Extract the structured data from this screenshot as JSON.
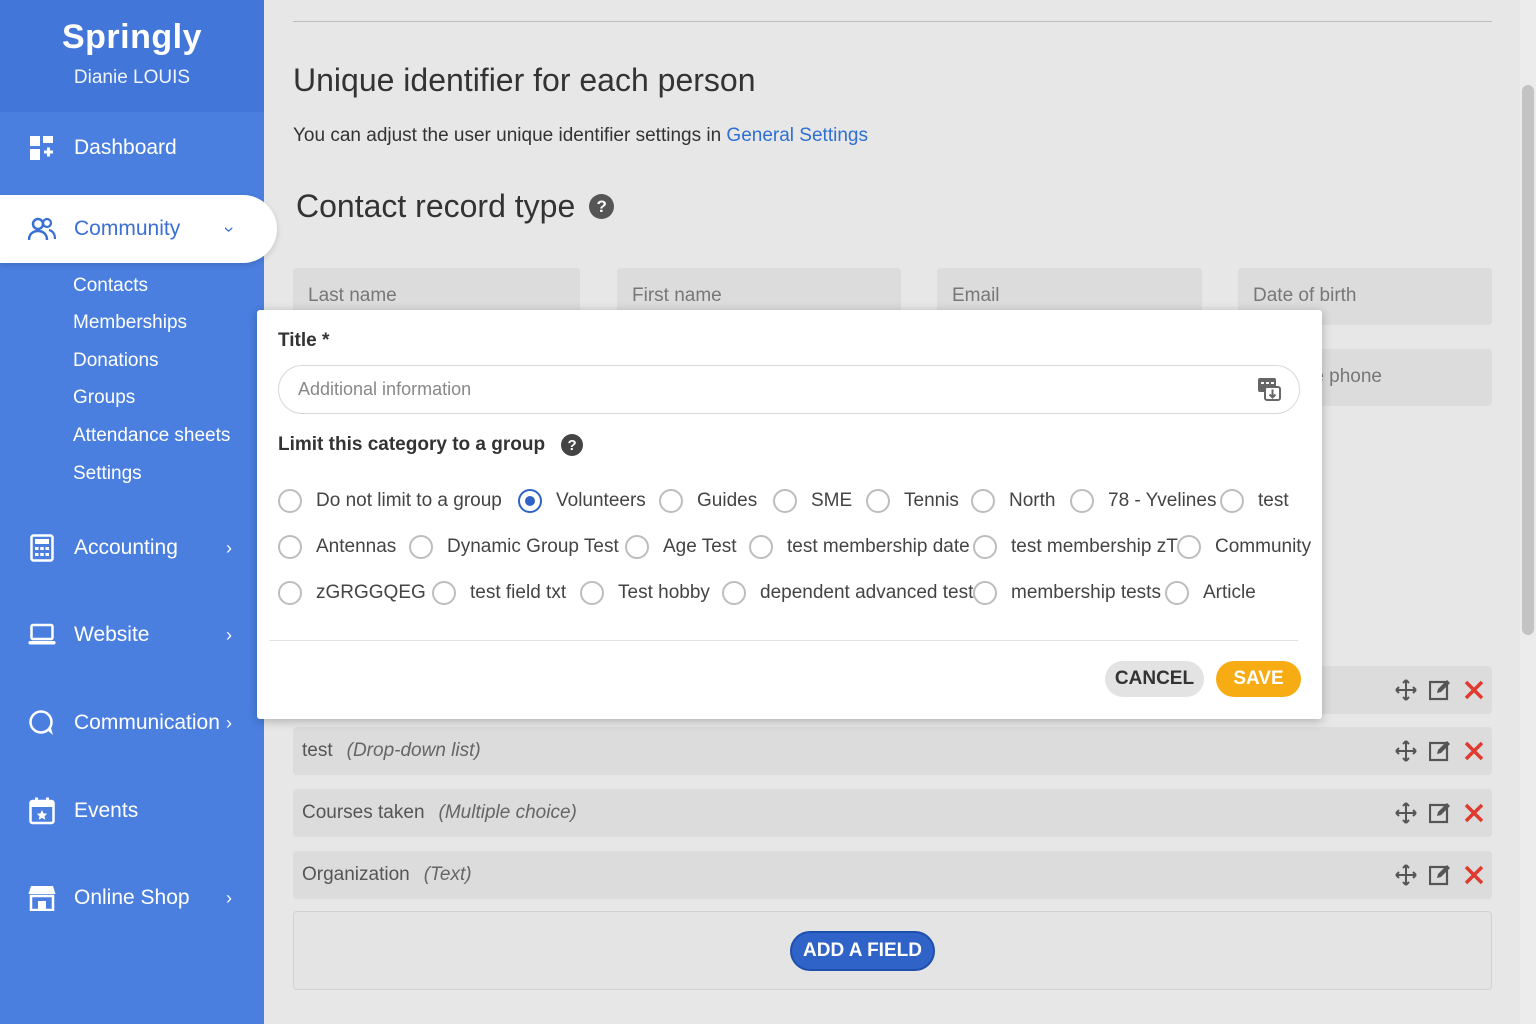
{
  "brand": {
    "name": "Springly",
    "user": "Dianie LOUIS"
  },
  "nav": {
    "dashboard": "Dashboard",
    "community": "Community",
    "community_sub": [
      "Contacts",
      "Memberships",
      "Donations",
      "Groups",
      "Attendance sheets",
      "Settings"
    ],
    "accounting": "Accounting",
    "website": "Website",
    "communication": "Communication",
    "events": "Events",
    "online_shop": "Online Shop"
  },
  "main": {
    "unique_title": "Unique identifier for each person",
    "adjust_text": "You can adjust the user unique identifier settings in ",
    "adjust_link": "General Settings",
    "contact_title": "Contact record type",
    "help": "?",
    "fields_top": [
      "Last name",
      "First name",
      "Email",
      "Date of birth"
    ],
    "phone_partial": "e phone",
    "field_rows": [
      {
        "name": "test",
        "type": "(Drop-down list)"
      },
      {
        "name": "Courses taken",
        "type": "(Multiple choice)"
      },
      {
        "name": "Organization",
        "type": "(Text)"
      }
    ],
    "add_field": "ADD A FIELD"
  },
  "modal": {
    "title_label": "Title *",
    "title_placeholder": "Additional information",
    "limit_label": "Limit this category to a group",
    "groups": [
      "Do not limit to a group",
      "Volunteers",
      "Guides",
      "SME",
      "Tennis",
      "North",
      "78 - Yvelines",
      "test",
      "Antennas",
      "Dynamic Group Test",
      "Age Test",
      "test membership date",
      "test membership zT",
      "Community",
      "zGRGGQEG",
      "test field txt",
      "Test hobby",
      "dependent advanced test",
      "membership tests",
      "Article"
    ],
    "selected": "Volunteers",
    "cancel": "CANCEL",
    "save": "SAVE"
  },
  "colors": {
    "sidebar": "#4a7fe0",
    "accent_blue": "#2f63c7",
    "save_orange": "#f7ac13",
    "delete_red": "#e03a2f"
  }
}
